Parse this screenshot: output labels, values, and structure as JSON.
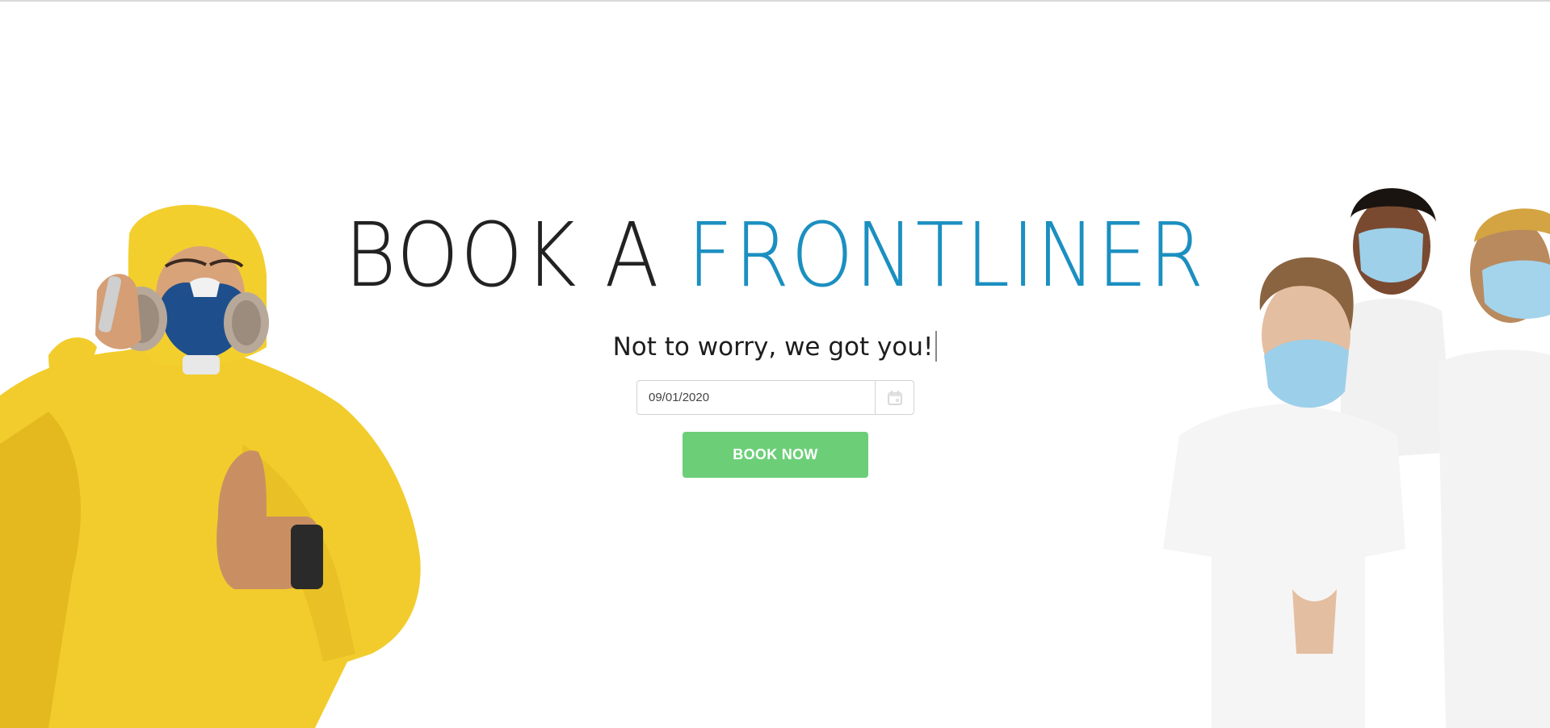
{
  "hero": {
    "title_dark": "BOOK A",
    "title_accent": "FRONTLINER",
    "tagline": "Not to worry, we got you!"
  },
  "booking": {
    "date_value": "09/01/2020",
    "calendar_icon": "calendar-icon",
    "button_label": "BOOK NOW"
  },
  "colors": {
    "accent": "#1b8fc0",
    "button": "#6ccf78",
    "text": "#222222"
  },
  "images": {
    "left": "worker in yellow hazmat suit with respirator on phone giving thumbs up",
    "right": "three people in white t-shirts wearing surgical masks"
  }
}
